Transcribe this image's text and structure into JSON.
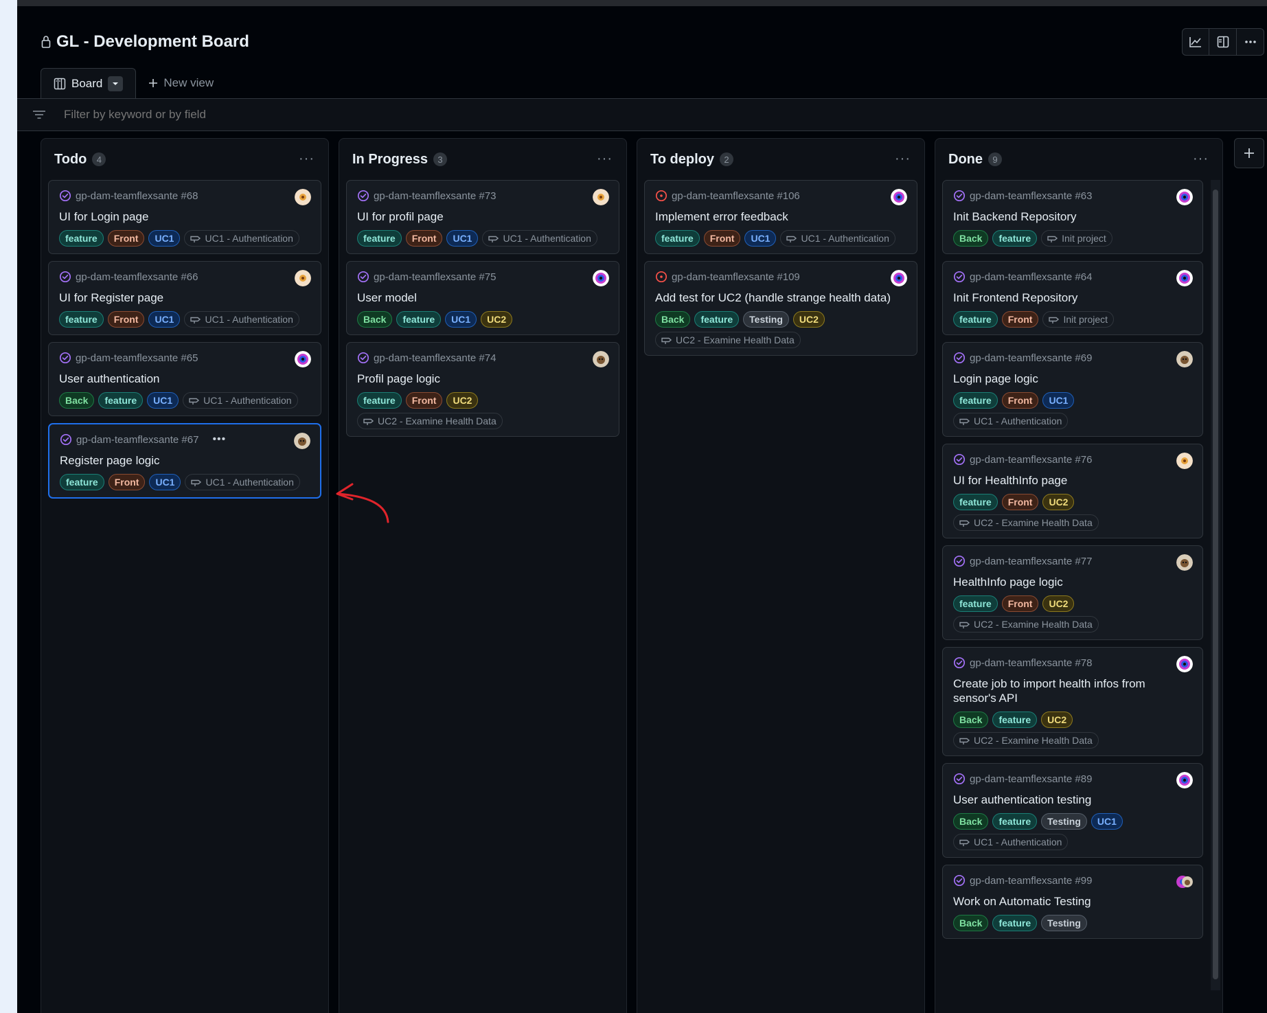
{
  "board": {
    "title": "GL - Development Board"
  },
  "tabs": {
    "board_label": "Board",
    "new_view_label": "New view"
  },
  "filter": {
    "placeholder": "Filter by keyword or by field"
  },
  "header_icons": [
    "insights-icon",
    "panel-icon",
    "more-icon"
  ],
  "colors": {
    "accent": "#1f6feb",
    "done_icon": "#a371f7",
    "open_icon": "#f85149"
  },
  "columns": [
    {
      "name": "Todo",
      "count": "4",
      "cards": [
        {
          "ref": "gp-dam-teamflexsante #68",
          "title": "UI for Login page",
          "status": "done",
          "avatar": "flower",
          "labels": [
            "feature",
            "Front",
            "UC1"
          ],
          "milestone": "UC1 - Authentication"
        },
        {
          "ref": "gp-dam-teamflexsante #66",
          "title": "UI for Register page",
          "status": "done",
          "avatar": "flower",
          "labels": [
            "feature",
            "Front",
            "UC1"
          ],
          "milestone": "UC1 - Authentication"
        },
        {
          "ref": "gp-dam-teamflexsante #65",
          "title": "User authentication",
          "status": "done",
          "avatar": "orb",
          "labels": [
            "Back",
            "feature",
            "UC1"
          ],
          "milestone": "UC1 - Authentication"
        },
        {
          "ref": "gp-dam-teamflexsante #67",
          "title": "Register page logic",
          "status": "done",
          "avatar": "dog",
          "selected": true,
          "labels": [
            "feature",
            "Front",
            "UC1"
          ],
          "milestone": "UC1 - Authentication"
        }
      ]
    },
    {
      "name": "In Progress",
      "count": "3",
      "cards": [
        {
          "ref": "gp-dam-teamflexsante #73",
          "title": "UI for profil page",
          "status": "done",
          "avatar": "flower",
          "labels": [
            "feature",
            "Front",
            "UC1"
          ],
          "milestone": "UC1 - Authentication"
        },
        {
          "ref": "gp-dam-teamflexsante #75",
          "title": "User model",
          "status": "done",
          "avatar": "orb",
          "labels": [
            "Back",
            "feature",
            "UC1",
            "UC2"
          ],
          "milestone": ""
        },
        {
          "ref": "gp-dam-teamflexsante #74",
          "title": "Profil page logic",
          "status": "done",
          "avatar": "dog",
          "labels": [
            "feature",
            "Front",
            "UC2"
          ],
          "milestone": "UC2 - Examine Health Data"
        }
      ]
    },
    {
      "name": "To deploy",
      "count": "2",
      "cards": [
        {
          "ref": "gp-dam-teamflexsante #106",
          "title": "Implement error feedback",
          "status": "open",
          "avatar": "orb",
          "labels": [
            "feature",
            "Front",
            "UC1"
          ],
          "milestone": "UC1 - Authentication"
        },
        {
          "ref": "gp-dam-teamflexsante #109",
          "title": "Add test for UC2 (handle strange health data)",
          "status": "open",
          "avatar": "orb",
          "labels": [
            "Back",
            "feature",
            "Testing",
            "UC2"
          ],
          "milestone": "UC2 - Examine Health Data"
        }
      ]
    },
    {
      "name": "Done",
      "count": "9",
      "cards": [
        {
          "ref": "gp-dam-teamflexsante #63",
          "title": "Init Backend Repository",
          "status": "done",
          "avatar": "orb",
          "labels": [
            "Back",
            "feature"
          ],
          "milestone": "Init project"
        },
        {
          "ref": "gp-dam-teamflexsante #64",
          "title": "Init Frontend Repository",
          "status": "done",
          "avatar": "orb",
          "labels": [
            "feature",
            "Front"
          ],
          "milestone": "Init project"
        },
        {
          "ref": "gp-dam-teamflexsante #69",
          "title": "Login page logic",
          "status": "done",
          "avatar": "dog",
          "labels": [
            "feature",
            "Front",
            "UC1"
          ],
          "milestone": "UC1 - Authentication"
        },
        {
          "ref": "gp-dam-teamflexsante #76",
          "title": "UI for HealthInfo page",
          "status": "done",
          "avatar": "flower",
          "labels": [
            "feature",
            "Front",
            "UC2"
          ],
          "milestone": "UC2 - Examine Health Data"
        },
        {
          "ref": "gp-dam-teamflexsante #77",
          "title": "HealthInfo page logic",
          "status": "done",
          "avatar": "dog",
          "labels": [
            "feature",
            "Front",
            "UC2"
          ],
          "milestone": "UC2 - Examine Health Data"
        },
        {
          "ref": "gp-dam-teamflexsante #78",
          "title": "Create job to import health infos from sensor's API",
          "status": "done",
          "avatar": "orb",
          "labels": [
            "Back",
            "feature",
            "UC2"
          ],
          "milestone": "UC2 - Examine Health Data"
        },
        {
          "ref": "gp-dam-teamflexsante #89",
          "title": "User authentication testing",
          "status": "done",
          "avatar": "orb",
          "labels": [
            "Back",
            "feature",
            "Testing",
            "UC1"
          ],
          "milestone": "UC1 - Authentication"
        },
        {
          "ref": "gp-dam-teamflexsante #99",
          "title": "Work on Automatic Testing",
          "status": "done",
          "avatar": "pair",
          "labels": [
            "Back",
            "feature",
            "Testing"
          ],
          "milestone": ""
        }
      ]
    }
  ]
}
